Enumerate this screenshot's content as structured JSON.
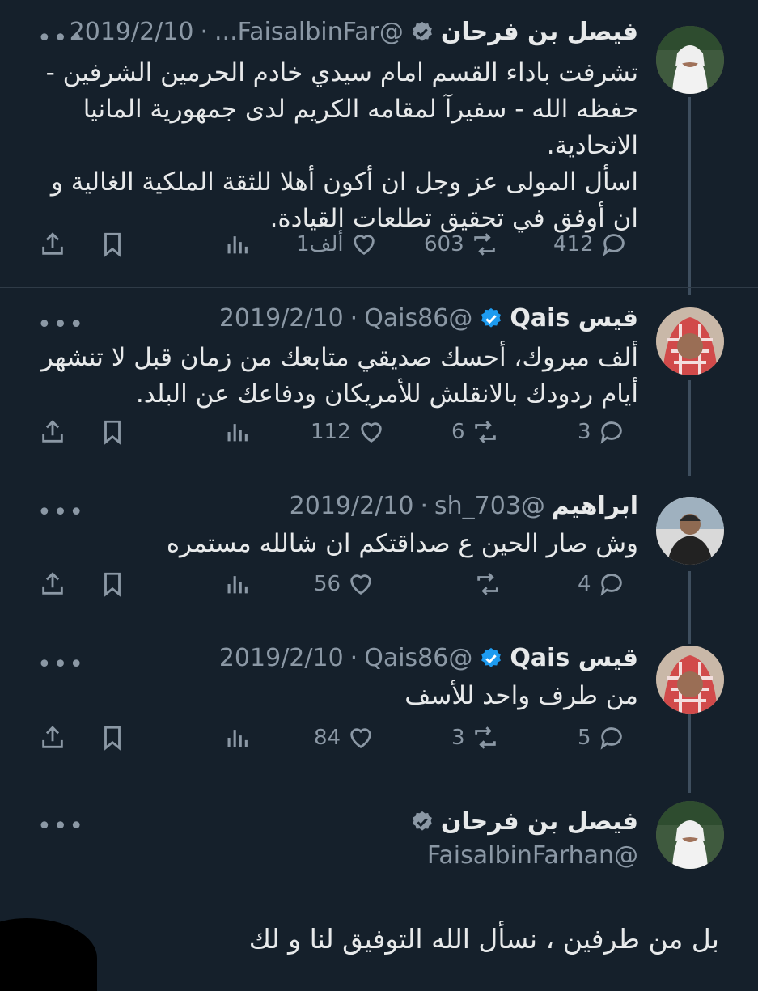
{
  "tweets": [
    {
      "name": "فيصل بن فرحان",
      "handle": "@FaisalbinFar...",
      "date": "2019/2/10",
      "text": "تشرفت باداء القسم امام سيدي خادم الحرمين الشرفين - حفظه الله - سفيرآ لمقامه الكريم لدى جمهورية المانيا الاتحادية.\nاسأل المولى عز وجل ان أكون أهلا للثقة الملكية الغالية و ان أوفق في تحقيق تطلعات القيادة.",
      "replies": "412",
      "retweets": "603",
      "likes": "1ألف",
      "verified_color": "#8b98a5"
    },
    {
      "name": "قيس Qais",
      "handle": "@Qais86",
      "date": "2019/2/10",
      "text": "ألف مبروك، أحسك صديقي متابعك من زمان قبل لا تنشهر أيام ردودك بالانقلش للأمريكان ودفاعك عن البلد.",
      "replies": "3",
      "retweets": "6",
      "likes": "112",
      "verified_color": "#1d9bf0"
    },
    {
      "name": "ابراهيم",
      "handle": "@sh_703",
      "date": "2019/2/10",
      "text": "وش صار الحين ع صداقتكم ان شالله مستمره",
      "replies": "4",
      "retweets": "",
      "likes": "56"
    },
    {
      "name": "قيس Qais",
      "handle": "@Qais86",
      "date": "2019/2/10",
      "text": "من طرف واحد للأسف",
      "replies": "5",
      "retweets": "3",
      "likes": "84",
      "verified_color": "#1d9bf0"
    }
  ],
  "main_tweet": {
    "name": "فيصل بن فرحان",
    "handle": "@FaisalbinFarhan",
    "text": "بل من طرفين ، نسأل الله التوفيق لنا و لك",
    "verified_color": "#8b98a5"
  },
  "icons": {
    "reply": "reply-icon",
    "retweet": "retweet-icon",
    "like": "heart-icon",
    "views": "views-icon",
    "bookmark": "bookmark-icon",
    "share": "share-icon",
    "more": "more-icon",
    "verified": "verified-badge-icon"
  },
  "more_glyph": "•••",
  "dot": "·"
}
